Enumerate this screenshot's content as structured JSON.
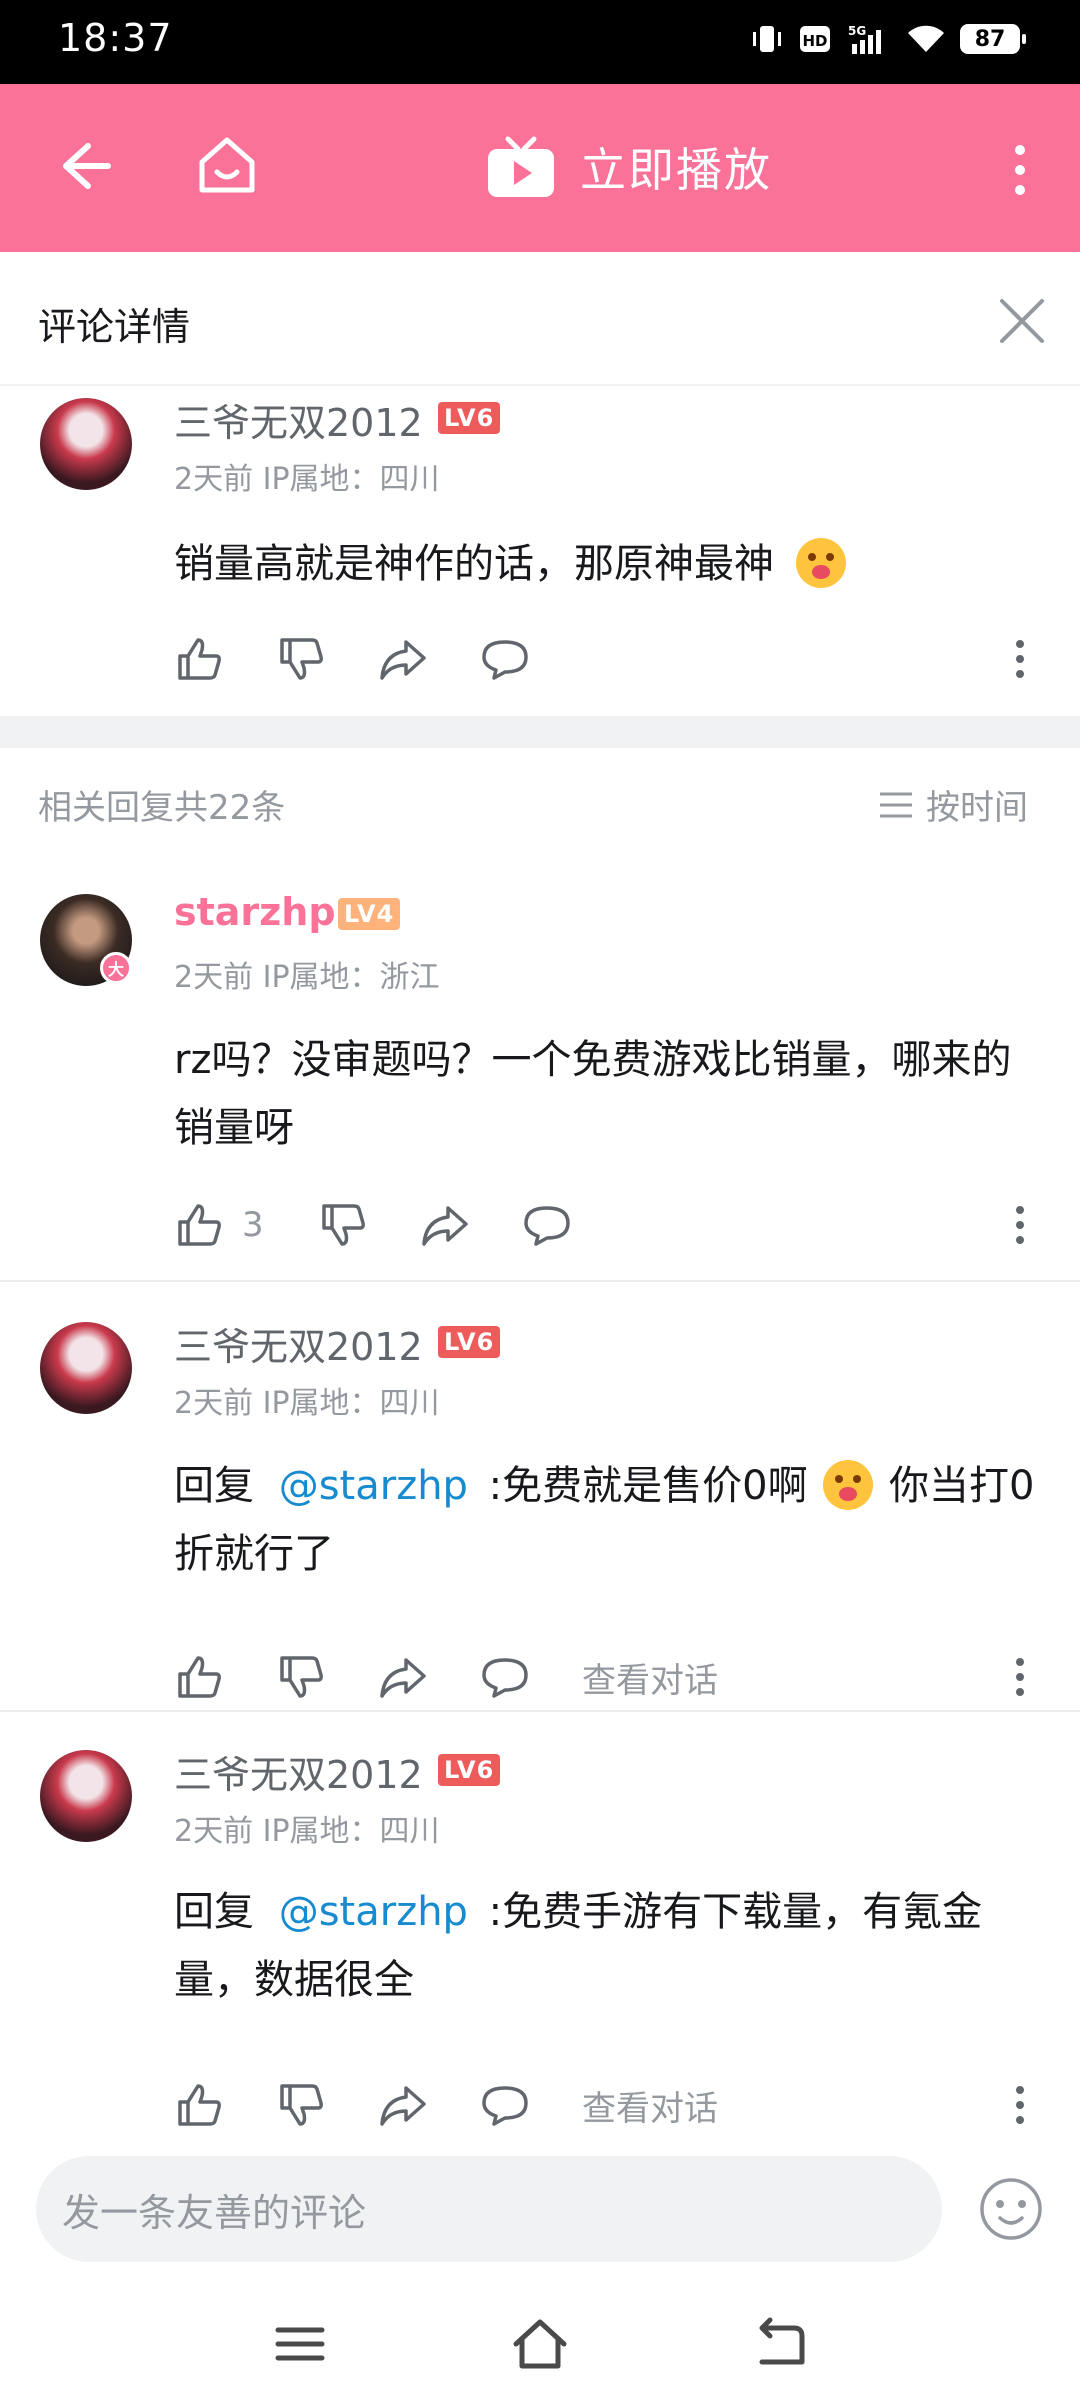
{
  "status_bar": {
    "time": "18:37",
    "network": "5G",
    "battery": "87"
  },
  "top_bar": {
    "play_label": "立即播放"
  },
  "detail": {
    "title": "评论详情"
  },
  "main_comment": {
    "username": "三爷无双2012",
    "level": "LV6",
    "meta": "2天前  IP属地：四川",
    "text": "销量高就是神作的话，那原神最神"
  },
  "replies_header": {
    "count_label": "相关回复共22条",
    "sort_label": "按时间"
  },
  "replies": [
    {
      "username": "starzhp",
      "level": "LV4",
      "badge": "大",
      "meta": "2天前  IP属地：浙江",
      "text": "rz吗？没审题吗？一个免费游戏比销量，哪来的销量呀",
      "like_count": "3"
    },
    {
      "username": "三爷无双2012",
      "level": "LV6",
      "meta": "2天前  IP属地：四川",
      "reply_prefix": "回复",
      "mention": "@starzhp",
      "text_a": ":免费就是售价0啊",
      "text_b": "你当打0折就行了",
      "view_conversation": "查看对话"
    },
    {
      "username": "三爷无双2012",
      "level": "LV6",
      "meta": "2天前  IP属地：四川",
      "reply_prefix": "回复",
      "mention": "@starzhp",
      "text_a": ":免费手游有下载量，有氪金量，数据很全",
      "view_conversation": "查看对话"
    }
  ],
  "comment_input": {
    "placeholder": "发一条友善的评论"
  },
  "colors": {
    "brand_pink": "#fb7299",
    "mention_blue": "#178bcf",
    "level_red": "#ee5b5b",
    "level_orange": "#ffb27a"
  }
}
